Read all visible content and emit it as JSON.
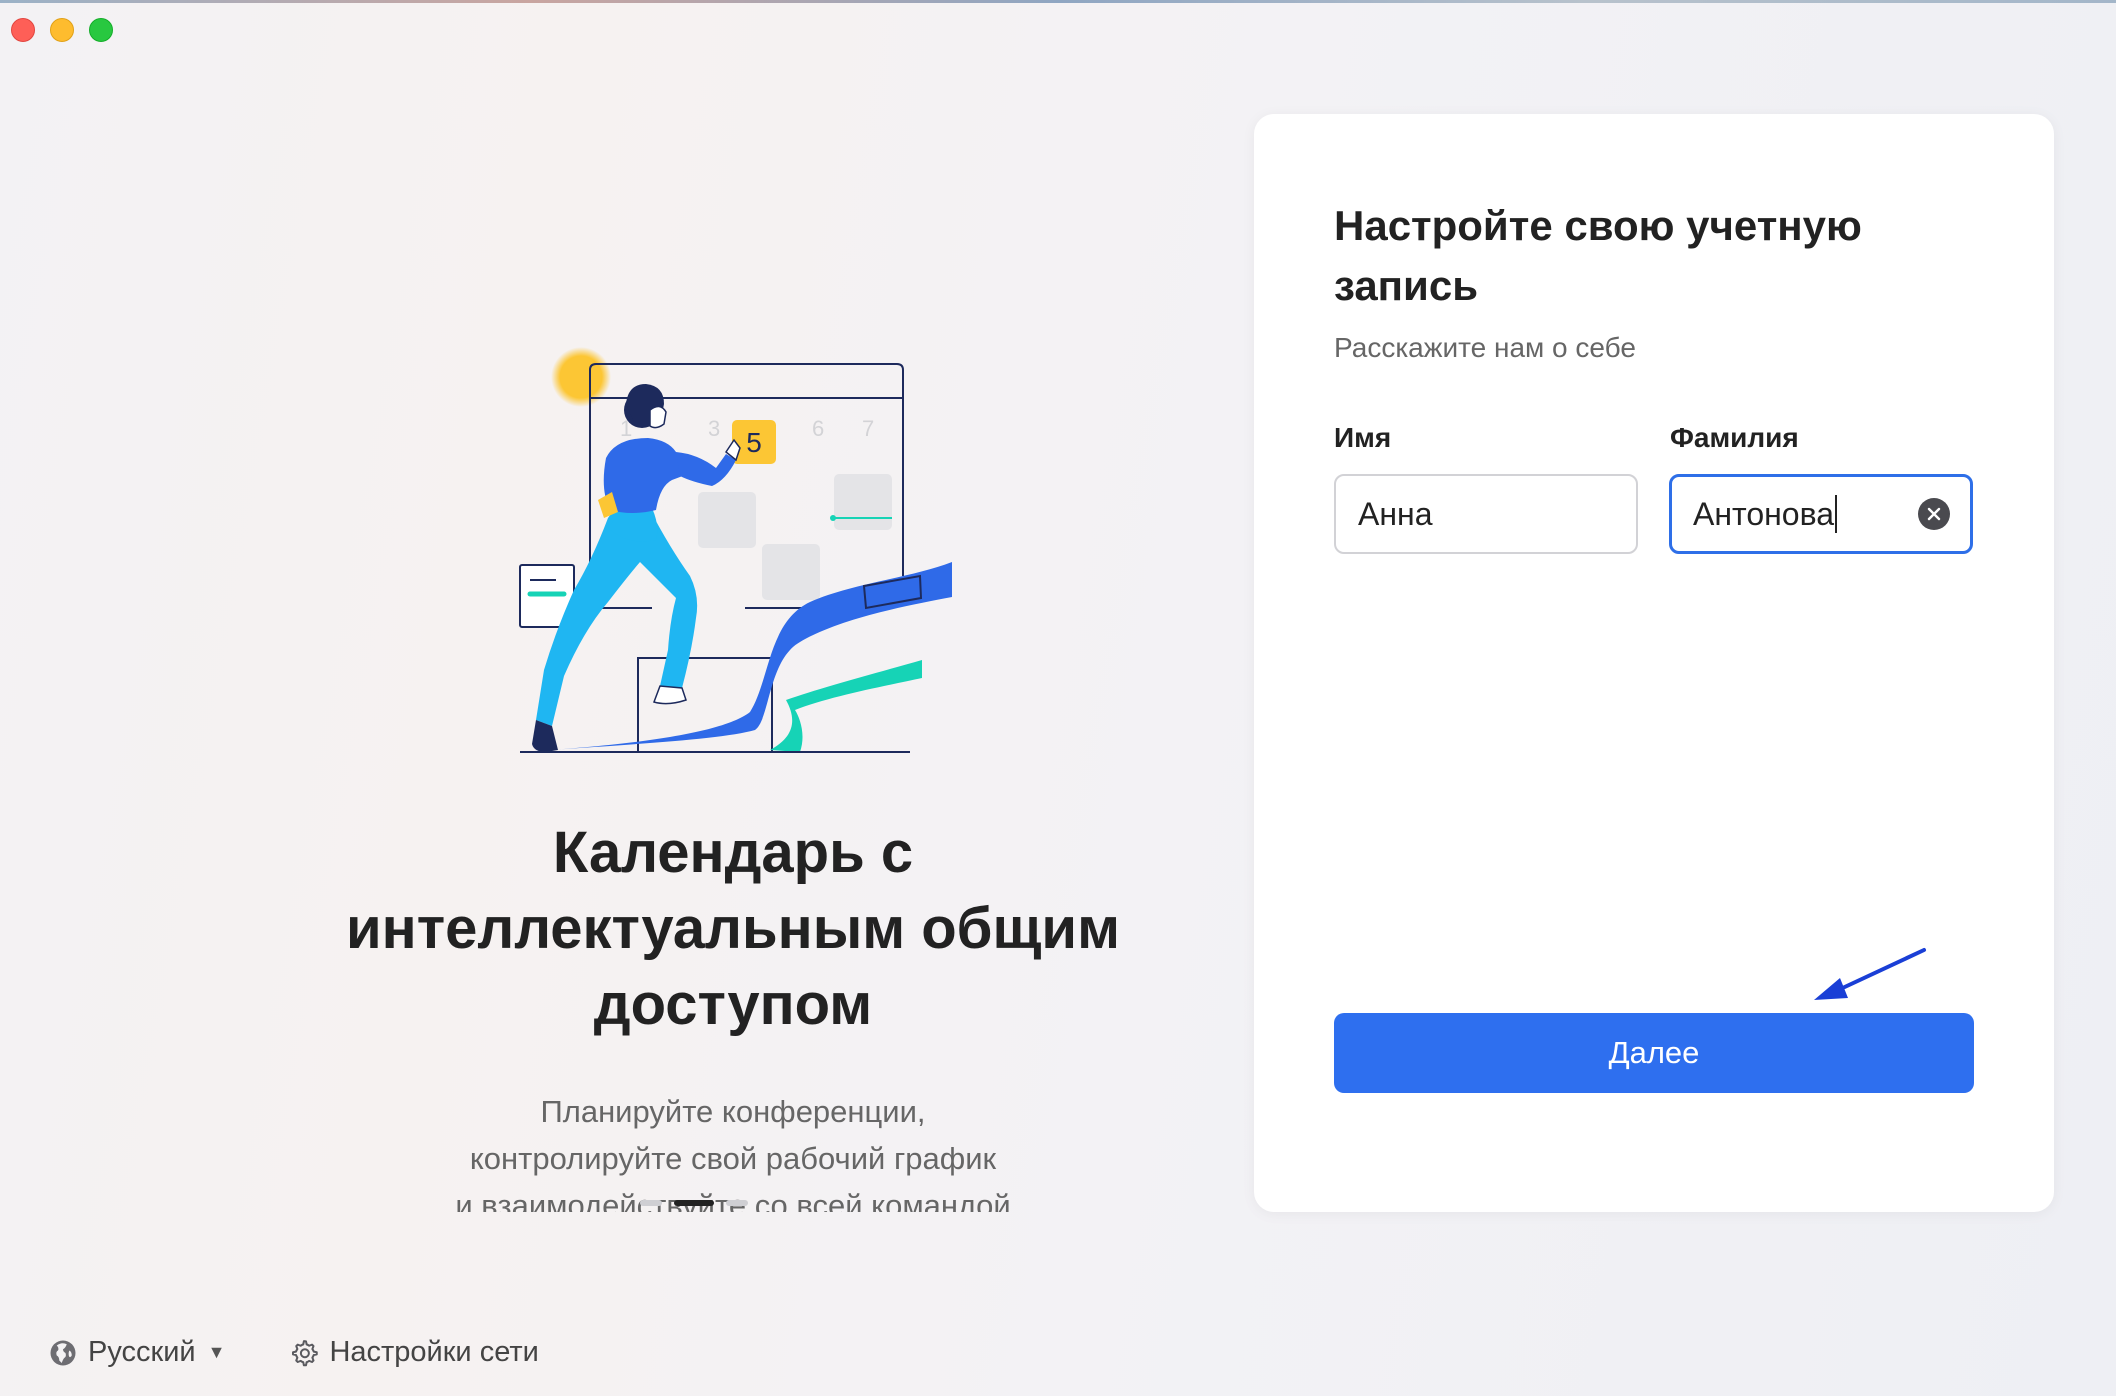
{
  "window": {
    "controls": [
      "close",
      "minimize",
      "zoom"
    ]
  },
  "onboarding": {
    "headline_line1": "Календарь с",
    "headline_line2": "интеллектуальным общим",
    "headline_line3": "доступом",
    "description_line1": "Планируйте конференции,",
    "description_line2": "контролируйте свой рабочий график",
    "description_line3": "и взаимодействуйте со всей командой",
    "calendar_highlight_day": "5",
    "calendar_faint_days": [
      "1",
      "3",
      "6",
      "7"
    ],
    "carousel_pages": 3,
    "carousel_active_index": 1
  },
  "footer": {
    "language_label": "Русский",
    "network_settings_label": "Настройки сети",
    "language_icon": "globe-icon",
    "network_icon": "gear-icon"
  },
  "account_form": {
    "title": "Настройте свою учетную запись",
    "subtitle": "Расскажите нам о себе",
    "first_name_label": "Имя",
    "first_name_value": "Анна",
    "last_name_label": "Фамилия",
    "last_name_value": "Антонова",
    "next_button_label": "Далее"
  },
  "colors": {
    "primary": "#2e6fef",
    "focus_border": "#2e6fe8",
    "illustration_blue": "#2f6ae8",
    "illustration_cyan": "#1fb6f2",
    "illustration_teal": "#16d3b6",
    "illustration_yellow": "#fcc634",
    "annotation_arrow": "#1a3fd6"
  }
}
